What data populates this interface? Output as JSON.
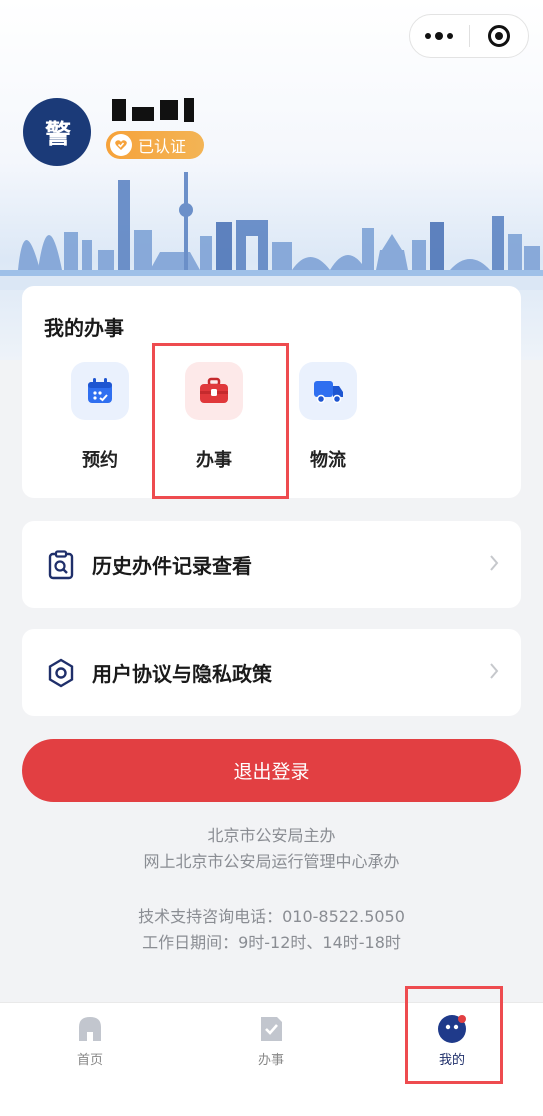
{
  "header": {
    "avatar_text": "警",
    "verified_label": "已认证"
  },
  "services": {
    "title": "我的办事",
    "items": [
      {
        "label": "预约",
        "icon": "calendar-icon",
        "bg": "#eaf1fd",
        "color": "#2f6ff0"
      },
      {
        "label": "办事",
        "icon": "briefcase-icon",
        "bg": "#fde9e9",
        "color": "#e0383b"
      },
      {
        "label": "物流",
        "icon": "truck-icon",
        "bg": "#eaf1fd",
        "color": "#2f6ff0"
      }
    ]
  },
  "menu": [
    {
      "label": "历史办件记录查看",
      "icon": "clipboard-search-icon"
    },
    {
      "label": "用户协议与隐私政策",
      "icon": "hexagon-shield-icon"
    }
  ],
  "logout_label": "退出登录",
  "footer": {
    "line1": "北京市公安局主办",
    "line2": "网上北京市公安局运行管理中心承办",
    "line3": "技术支持咨询电话：010-8522.5050",
    "line4": "工作日期间：9时-12时、14时-18时"
  },
  "tabbar": [
    {
      "label": "首页",
      "icon": "home-icon"
    },
    {
      "label": "办事",
      "icon": "task-check-icon"
    },
    {
      "label": "我的",
      "icon": "profile-icon",
      "active": true
    }
  ],
  "colors": {
    "primary_red": "#e23f42",
    "highlight_red": "#ee4b4f",
    "badge_orange": "#f6a23a",
    "navy": "#1b3a78"
  }
}
